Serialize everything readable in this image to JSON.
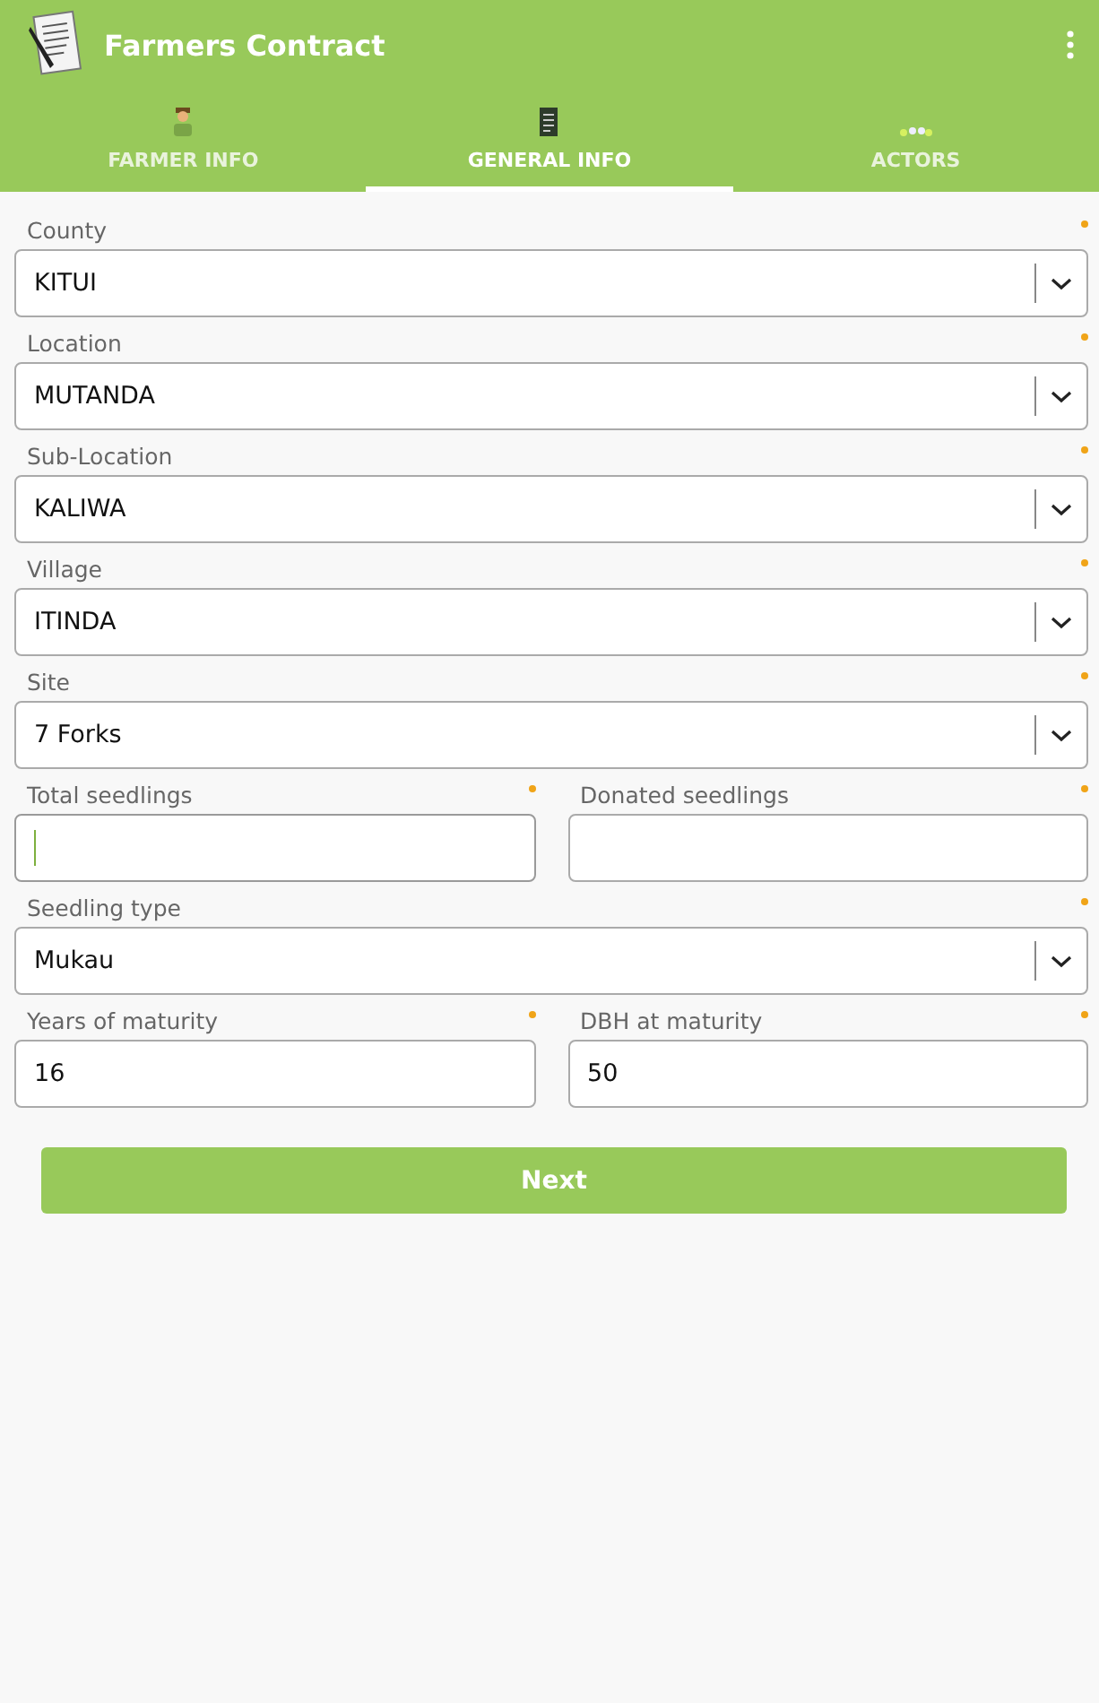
{
  "app_bar": {
    "title": "Farmers Contract"
  },
  "tabs": [
    {
      "label": "FARMER INFO",
      "selected": false
    },
    {
      "label": "GENERAL INFO",
      "selected": true
    },
    {
      "label": "ACTORS",
      "selected": false
    }
  ],
  "rows": [
    {
      "fields": [
        {
          "kind": "select",
          "label": "County",
          "value": "KITUI",
          "required": true
        }
      ]
    },
    {
      "fields": [
        {
          "kind": "select",
          "label": "Location",
          "value": "MUTANDA",
          "required": true
        }
      ]
    },
    {
      "fields": [
        {
          "kind": "select",
          "label": "Sub-Location",
          "value": "KALIWA",
          "required": true
        }
      ]
    },
    {
      "fields": [
        {
          "kind": "select",
          "label": "Village",
          "value": "ITINDA",
          "required": true
        }
      ]
    },
    {
      "fields": [
        {
          "kind": "select",
          "label": "Site",
          "value": "7 Forks",
          "required": true
        }
      ]
    },
    {
      "fields": [
        {
          "kind": "input",
          "label": "Total seedlings",
          "required": true,
          "focused": true
        },
        {
          "kind": "input",
          "label": "Donated seedlings",
          "required": true,
          "focused": false
        }
      ]
    },
    {
      "fields": [
        {
          "kind": "select",
          "label": "Seedling type",
          "value": "Mukau",
          "required": true
        }
      ]
    },
    {
      "fields": [
        {
          "kind": "input",
          "label": "Years of maturity",
          "value": "16",
          "required": true,
          "focused": false
        },
        {
          "kind": "input",
          "label": "DBH at maturity",
          "value": "50",
          "required": true,
          "focused": false
        }
      ]
    }
  ],
  "next_button": "Next"
}
